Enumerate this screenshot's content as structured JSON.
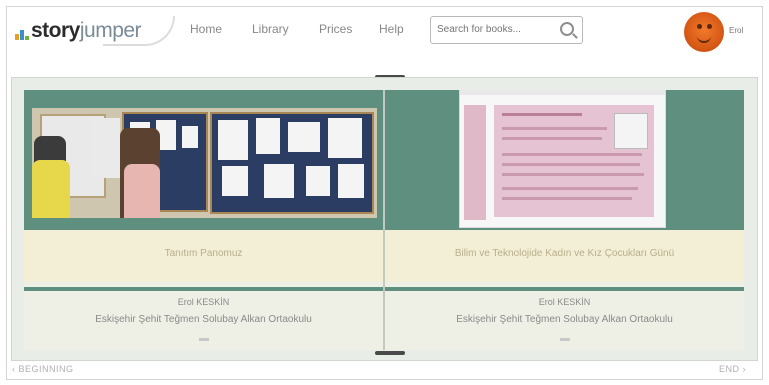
{
  "header": {
    "logo": {
      "story": "story",
      "jumper": "jumper"
    },
    "nav": [
      {
        "label": "Home"
      },
      {
        "label": "Library"
      },
      {
        "label": "Prices"
      },
      {
        "label": "Help"
      }
    ],
    "search": {
      "placeholder": "Search for books..."
    },
    "user": {
      "name": "Erol"
    }
  },
  "book": {
    "left_page": {
      "caption": "Tanıtım Panomuz",
      "author": "Erol KESKİN",
      "school": "Eskişehir Şehit Teğmen Solubay Alkan Ortaokulu"
    },
    "right_page": {
      "caption": "Bilim ve Teknolojide Kadın ve Kız Çocukları Günü",
      "author": "Erol KESKİN",
      "school": "Eskişehir Şehit Teğmen Solubay Alkan Ortaokulu"
    }
  },
  "footer": {
    "beginning": "‹ BEGINNING",
    "end": "END ›"
  },
  "colors": {
    "page_green": "#5f8f7f",
    "caption_band": "#f3efd6",
    "avatar": "#e0661f"
  }
}
